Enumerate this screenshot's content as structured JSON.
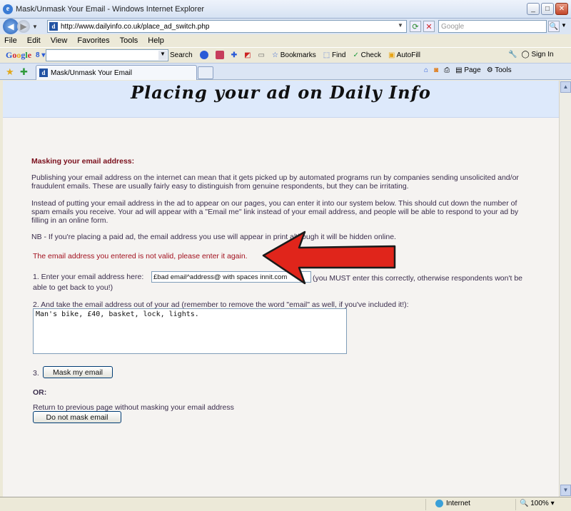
{
  "window": {
    "title": "Mask/Unmask Your Email - Windows Internet Explorer"
  },
  "address": {
    "url": "http://www.dailyinfo.co.uk/place_ad_switch.php",
    "search_placeholder": "Google"
  },
  "menu": [
    "File",
    "Edit",
    "View",
    "Favorites",
    "Tools",
    "Help"
  ],
  "google_toolbar": {
    "logo": [
      "G",
      "o",
      "o",
      "g",
      "l",
      "e"
    ],
    "selector": "8 ▾",
    "search_label": "Search",
    "bookmarks_label": "Bookmarks",
    "find_label": "Find",
    "check_label": "Check",
    "autofill_label": "AutoFill",
    "signin_label": "Sign In"
  },
  "tab": {
    "title": "Mask/Unmask Your Email"
  },
  "commands": {
    "page_label": "Page",
    "tools_label": "Tools"
  },
  "page": {
    "banner_title": "Placing your ad on Daily Info",
    "heading": "Masking your email address:",
    "para1": "Publishing your email address on the internet can mean that it gets picked up by automated programs run by companies sending unsolicited and/or fraudulent emails. These are usually fairly easy to distinguish from genuine respondents, but they can be irritating.",
    "para2": "Instead of putting your email address in the ad to appear on our pages, you can enter it into our system below. This should cut down the number of spam emails you receive. Your ad will appear with a \"Email me\" link instead of your email address, and people will be able to respond to your ad by filling in an online form.",
    "para3": "NB - If you're placing a paid ad, the email address you use will appear in print although it will be hidden online.",
    "error": "The email address you entered is not valid, please enter it again.",
    "step1_label": "1. Enter your email address here:",
    "email_value": "£bad email^address@ with spaces innit.com",
    "step1_note": "(you MUST enter this correctly, otherwise respondents won't be",
    "step1_note2": "able to get back to you!)",
    "step2_label": "2. And take the email address out of your ad (remember to remove the word \"email\" as well, if you've included it!):",
    "ad_text": "Man's bike, £40, basket, lock, lights.",
    "step3_prefix": "3.",
    "mask_button": "Mask my email",
    "or_label": "OR:",
    "return_text": "Return to previous page without masking your email address",
    "no_mask_button": "Do not mask email"
  },
  "status": {
    "zone": "Internet",
    "zoom": "100%"
  }
}
